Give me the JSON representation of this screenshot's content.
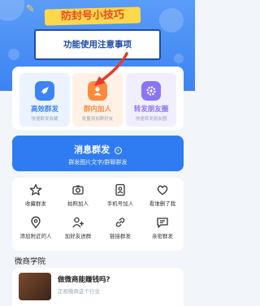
{
  "hero": {
    "title": "防封号小技巧",
    "subtitle": "功能使用注意事项"
  },
  "features": [
    {
      "label": "高效群发",
      "desc": "快速群发收藏",
      "icon": "rocket-icon",
      "color": "#3d84f2",
      "bg": "#eaf3ff"
    },
    {
      "label": "群内加人",
      "desc": "批量添加群好友",
      "icon": "add-user-icon",
      "color": "#ff8a3d",
      "bg": "#fff1e6"
    },
    {
      "label": "转发朋友圈",
      "desc": "快速转发朋友圈",
      "icon": "gear-icon",
      "color": "#8b74f5",
      "bg": "#f1efff"
    }
  ],
  "mass_send": {
    "label": "消息群发",
    "arrow": "›",
    "desc": "群发图片文字/群聊群发"
  },
  "tools": [
    {
      "label": "收藏群发",
      "icon": "star-icon"
    },
    {
      "label": "拍照加人",
      "icon": "camera-icon"
    },
    {
      "label": "手机号加人",
      "icon": "phone-book-icon"
    },
    {
      "label": "看谁删了我",
      "icon": "heart-icon"
    },
    {
      "label": "添加附近的人",
      "icon": "location-icon"
    },
    {
      "label": "加好友进群",
      "icon": "add-friend-icon"
    },
    {
      "label": "链接群发",
      "icon": "link-icon"
    },
    {
      "label": "亲密群发",
      "icon": "message-icon"
    }
  ],
  "academy": {
    "title": "微商学院",
    "article_title": "做微商能赚钱吗?",
    "article_desc": "正视微商这个行业"
  }
}
